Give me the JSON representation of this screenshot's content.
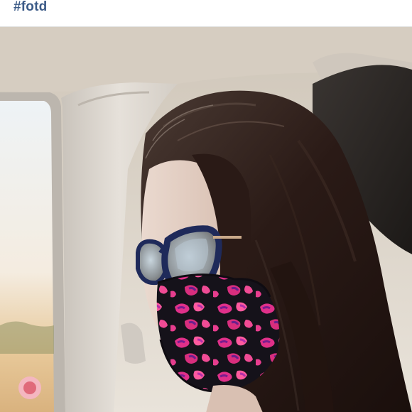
{
  "post": {
    "hashtag": "#fotd"
  },
  "photo": {
    "subject": "woman-in-car-wearing-mask-and-glasses",
    "colors": {
      "hair": "#2a1a16",
      "mask_base": "#15121a",
      "mask_pattern": "#e0308a",
      "glasses_frame": "#1f2a5a",
      "car_interior": "#d9d3ca"
    }
  }
}
